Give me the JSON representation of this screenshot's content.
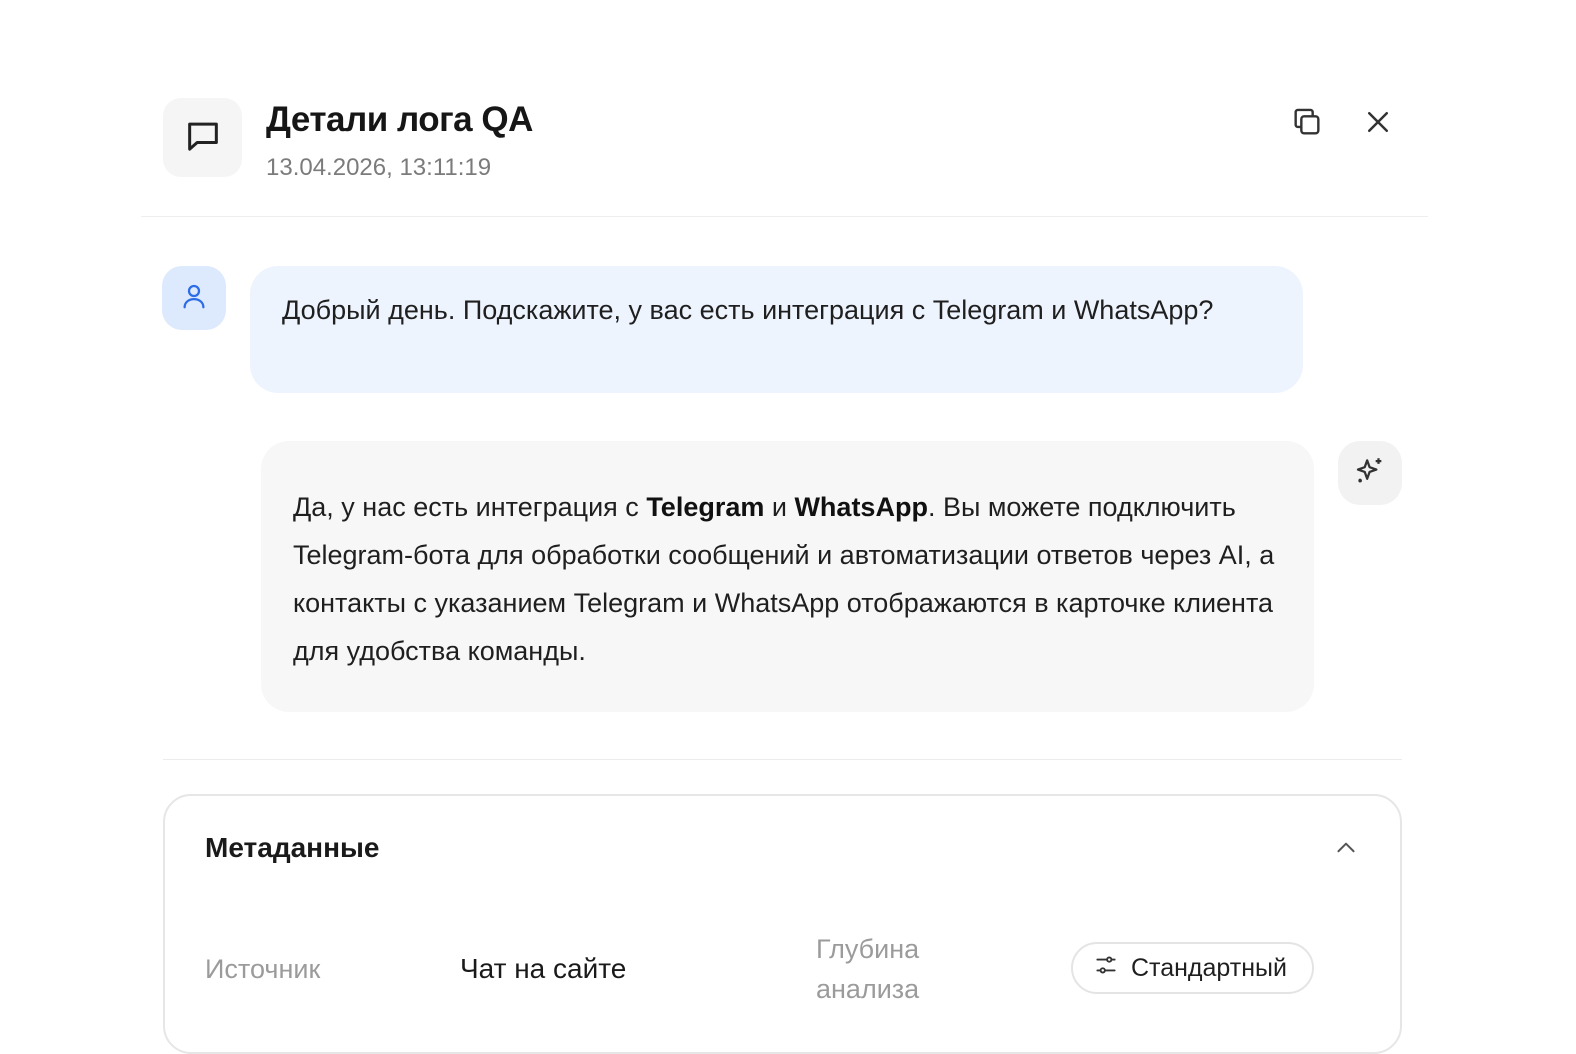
{
  "header": {
    "title": "Детали лога QA",
    "timestamp": "13.04.2026, 13:11:19",
    "icon": "message-square-icon",
    "actions": [
      "copy-icon",
      "close-icon"
    ]
  },
  "conversation": {
    "user_message": "Добрый день. Подскажите, у вас есть интеграция с Telegram и WhatsApp?",
    "bot_message": {
      "p1": "Да, у нас есть интеграция с ",
      "b1": "Telegram",
      "p2": " и ",
      "b2": "WhatsApp",
      "p3": ". Вы можете подключить Telegram-бота для обработки сообщений и автоматизации ответов через AI, а контакты с указанием Telegram и WhatsApp отображаются в карточке клиента для удобства команды."
    }
  },
  "metadata": {
    "title": "Метаданные",
    "source_label": "Источник",
    "source_value": "Чат на сайте",
    "depth_label": "Глубина анализа",
    "depth_value": "Стандартный"
  },
  "colors": {
    "user_bubble": "#eef4fe",
    "user_avatar": "#dde9fc",
    "user_icon": "#2b6de8",
    "bot_bubble": "#f7f7f7"
  }
}
